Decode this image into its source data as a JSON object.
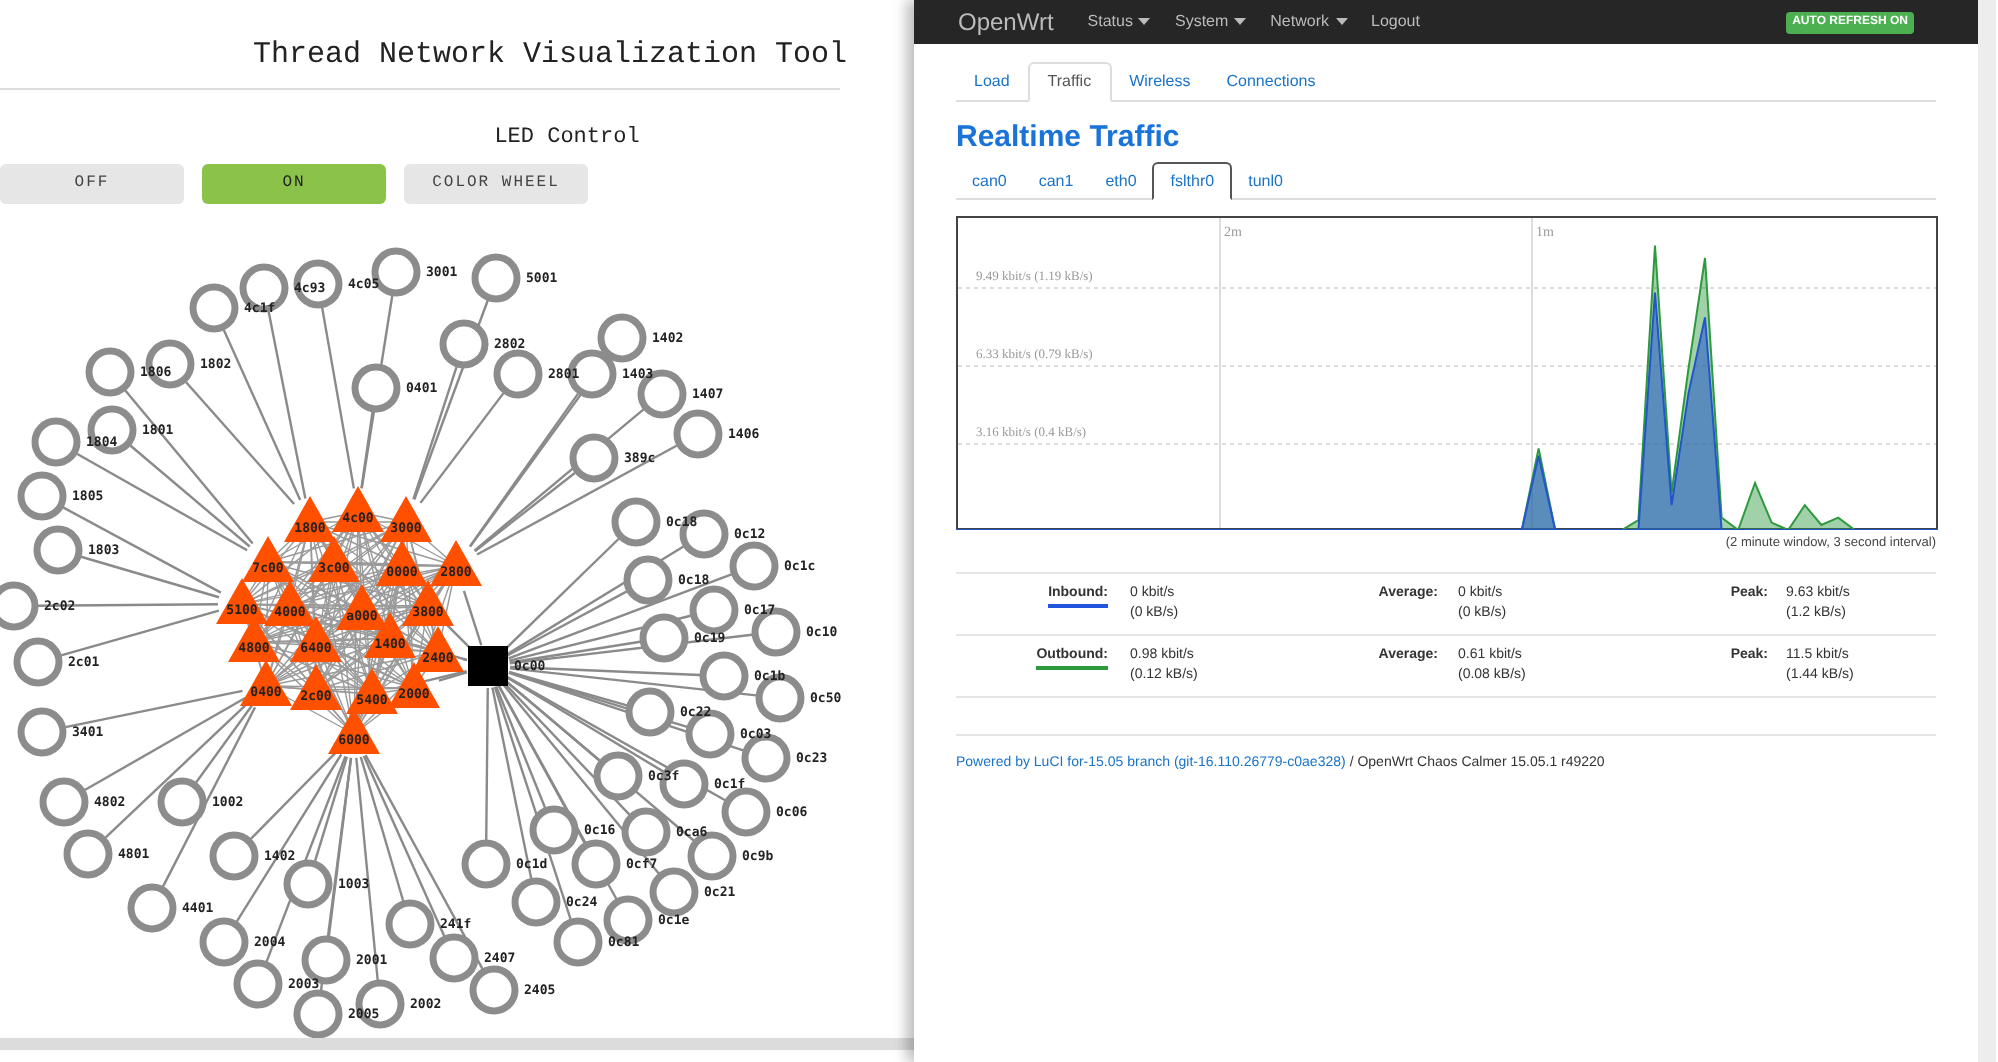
{
  "left": {
    "title": "Thread Network Visualization Tool",
    "led_control": {
      "label": "LED Control",
      "buttons": [
        {
          "label": "OFF",
          "selected": false
        },
        {
          "label": "ON",
          "selected": true
        },
        {
          "label": "COLOR WHEEL",
          "selected": false
        }
      ]
    },
    "graph": {
      "nodes": [
        {
          "kind": "router",
          "label": "1800"
        },
        {
          "kind": "router",
          "label": "4c00"
        },
        {
          "kind": "router",
          "label": "3000"
        },
        {
          "kind": "router",
          "label": "7c00"
        },
        {
          "kind": "router",
          "label": "3c00"
        },
        {
          "kind": "router",
          "label": "0000"
        },
        {
          "kind": "router",
          "label": "2800"
        },
        {
          "kind": "router",
          "label": "5100"
        },
        {
          "kind": "router",
          "label": "4000"
        },
        {
          "kind": "router",
          "label": "a000"
        },
        {
          "kind": "router",
          "label": "3800"
        },
        {
          "kind": "router",
          "label": "4800"
        },
        {
          "kind": "router",
          "label": "6400"
        },
        {
          "kind": "router",
          "label": "1400"
        },
        {
          "kind": "router",
          "label": "2400"
        },
        {
          "kind": "router",
          "label": "0400"
        },
        {
          "kind": "router",
          "label": "2c00"
        },
        {
          "kind": "router",
          "label": "5400"
        },
        {
          "kind": "router",
          "label": "2000"
        },
        {
          "kind": "router",
          "label": "6000"
        },
        {
          "kind": "leader",
          "label": "0c00"
        },
        {
          "kind": "child",
          "label": "4c1f"
        },
        {
          "kind": "child",
          "label": "4c93"
        },
        {
          "kind": "child",
          "label": "4c05"
        },
        {
          "kind": "child",
          "label": "3001"
        },
        {
          "kind": "child",
          "label": "5001"
        },
        {
          "kind": "child",
          "label": "1806"
        },
        {
          "kind": "child",
          "label": "1802"
        },
        {
          "kind": "child",
          "label": "0401"
        },
        {
          "kind": "child",
          "label": "2802"
        },
        {
          "kind": "child",
          "label": "2801"
        },
        {
          "kind": "child",
          "label": "1402"
        },
        {
          "kind": "child",
          "label": "1403"
        },
        {
          "kind": "child",
          "label": "1407"
        },
        {
          "kind": "child",
          "label": "1406"
        },
        {
          "kind": "child",
          "label": "389c"
        },
        {
          "kind": "child",
          "label": "1804"
        },
        {
          "kind": "child",
          "label": "1801"
        },
        {
          "kind": "child",
          "label": "1805"
        },
        {
          "kind": "child",
          "label": "1803"
        },
        {
          "kind": "child",
          "label": "2c02"
        },
        {
          "kind": "child",
          "label": "2c01"
        },
        {
          "kind": "child",
          "label": "3401"
        },
        {
          "kind": "child",
          "label": "4802"
        },
        {
          "kind": "child",
          "label": "4801"
        },
        {
          "kind": "child",
          "label": "4401"
        },
        {
          "kind": "child",
          "label": "1002"
        },
        {
          "kind": "child",
          "label": "1402"
        },
        {
          "kind": "child",
          "label": "1003"
        },
        {
          "kind": "child",
          "label": "2004"
        },
        {
          "kind": "child",
          "label": "2001"
        },
        {
          "kind": "child",
          "label": "2003"
        },
        {
          "kind": "child",
          "label": "2005"
        },
        {
          "kind": "child",
          "label": "2002"
        },
        {
          "kind": "child",
          "label": "241f"
        },
        {
          "kind": "child",
          "label": "2407"
        },
        {
          "kind": "child",
          "label": "2405"
        },
        {
          "kind": "child",
          "label": "0c18"
        },
        {
          "kind": "child",
          "label": "0c12"
        },
        {
          "kind": "child",
          "label": "0c1c"
        },
        {
          "kind": "child",
          "label": "0c18"
        },
        {
          "kind": "child",
          "label": "0c17"
        },
        {
          "kind": "child",
          "label": "0c10"
        },
        {
          "kind": "child",
          "label": "0c19"
        },
        {
          "kind": "child",
          "label": "0c1b"
        },
        {
          "kind": "child",
          "label": "0c50"
        },
        {
          "kind": "child",
          "label": "0c22"
        },
        {
          "kind": "child",
          "label": "0c03"
        },
        {
          "kind": "child",
          "label": "0c23"
        },
        {
          "kind": "child",
          "label": "0c3f"
        },
        {
          "kind": "child",
          "label": "0c1f"
        },
        {
          "kind": "child",
          "label": "0c06"
        },
        {
          "kind": "child",
          "label": "0c16"
        },
        {
          "kind": "child",
          "label": "0ca6"
        },
        {
          "kind": "child",
          "label": "0c9b"
        },
        {
          "kind": "child",
          "label": "0c1d"
        },
        {
          "kind": "child",
          "label": "0cf7"
        },
        {
          "kind": "child",
          "label": "0c21"
        },
        {
          "kind": "child",
          "label": "0c24"
        },
        {
          "kind": "child",
          "label": "0c1e"
        },
        {
          "kind": "child",
          "label": "0c81"
        }
      ]
    }
  },
  "right": {
    "navbar": {
      "brand": "OpenWrt",
      "menus": [
        {
          "label": "Status",
          "dropdown": true
        },
        {
          "label": "System",
          "dropdown": true
        },
        {
          "label": "Network",
          "dropdown": true
        },
        {
          "label": "Logout",
          "dropdown": false
        }
      ],
      "badge": "AUTO REFRESH ON"
    },
    "tabs": [
      {
        "label": "Load",
        "selected": false
      },
      {
        "label": "Traffic",
        "selected": true
      },
      {
        "label": "Wireless",
        "selected": false
      },
      {
        "label": "Connections",
        "selected": false
      }
    ],
    "title": "Realtime Traffic",
    "interface_tabs": [
      {
        "label": "can0",
        "selected": false
      },
      {
        "label": "can1",
        "selected": false
      },
      {
        "label": "eth0",
        "selected": false
      },
      {
        "label": "fslthr0",
        "selected": true
      },
      {
        "label": "tunl0",
        "selected": false
      }
    ],
    "chart": {
      "time_labels": [
        "2m",
        "1m"
      ],
      "rate_labels": [
        "9.49 kbit/s (1.19 kB/s)",
        "6.33 kbit/s (0.79 kB/s)",
        "3.16 kbit/s (0.4 kB/s)"
      ]
    },
    "chart_note": "(2 minute window, 3 second interval)",
    "stats": [
      {
        "label": "Inbound:",
        "color": "#2255dd",
        "current": "0 kbit/s",
        "current_bytes": "(0 kB/s)",
        "average_label": "Average:",
        "average": "0 kbit/s",
        "average_bytes": "(0 kB/s)",
        "peak_label": "Peak:",
        "peak": "9.63 kbit/s",
        "peak_bytes": "(1.2 kB/s)"
      },
      {
        "label": "Outbound:",
        "color": "#2e9a3e",
        "current": "0.98 kbit/s",
        "current_bytes": "(0.12 kB/s)",
        "average_label": "Average:",
        "average": "0.61 kbit/s",
        "average_bytes": "(0.08 kB/s)",
        "peak_label": "Peak:",
        "peak": "11.5 kbit/s",
        "peak_bytes": "(1.44 kB/s)"
      }
    ],
    "footer": {
      "link": "Powered by LuCI for-15.05 branch (git-16.110.26779-c0ae328)",
      "text": "/ OpenWrt Chaos Calmer 15.05.1 r49220"
    }
  }
}
